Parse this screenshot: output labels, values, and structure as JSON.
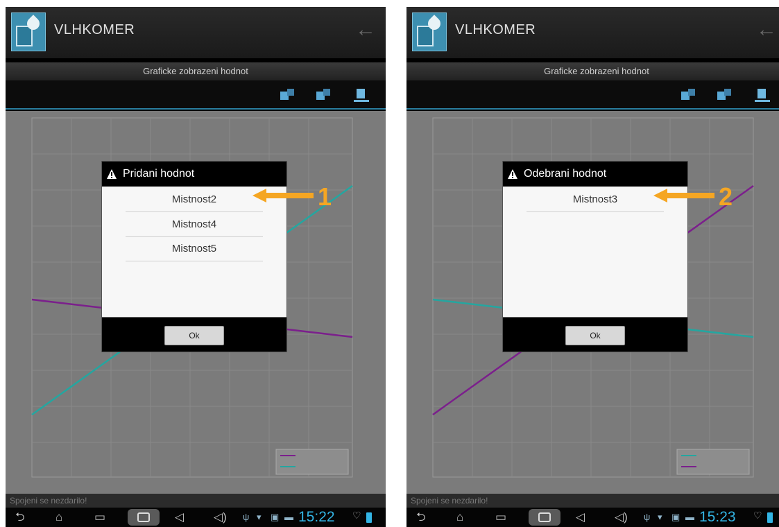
{
  "screens": [
    {
      "app_title": "VLHKOMER",
      "subtitle": "Graficke zobrazeni hodnot",
      "status_message": "Spojeni se nezdarilo!",
      "clock": "15:22",
      "dialog": {
        "title": "Pridani hodnot",
        "items": [
          "Mistnost2",
          "Mistnost4",
          "Mistnost5"
        ],
        "ok_label": "Ok"
      },
      "callout_number": "1",
      "series_colors": {
        "humidity": "#24a6a0",
        "temperature": "#7b1f8c"
      }
    },
    {
      "app_title": "VLHKOMER",
      "subtitle": "Graficke zobrazeni hodnot",
      "status_message": "Spojeni se nezdarilo!",
      "clock": "15:23",
      "dialog": {
        "title": "Odebrani hodnot",
        "items": [
          "Mistnost3"
        ],
        "ok_label": "Ok"
      },
      "callout_number": "2",
      "series_colors": {
        "humidity": "#7b1f8c",
        "temperature": "#24a6a0"
      }
    }
  ],
  "colors": {
    "callout": "#f5a623",
    "accent": "#33b5e5"
  }
}
